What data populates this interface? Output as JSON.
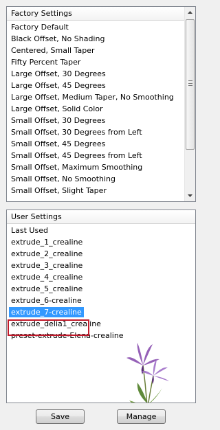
{
  "factory": {
    "header": "Factory Settings",
    "items": [
      "Factory Default",
      "Black Offset, No Shading",
      "Centered, Small Taper",
      "Fifty Percent Taper",
      "Large Offset, 30 Degrees",
      "Large Offset, 45 Degrees",
      "Large Offset, Medium Taper, No Smoothing",
      "Large Offset, Solid Color",
      "Small Offset, 30 Degrees",
      "Small Offset, 30 Degrees from Left",
      "Small Offset, 45 Degrees",
      "Small Offset, 45 Degrees from Left",
      "Small Offset, Maximum Smoothing",
      "Small Offset, No Smoothing",
      "Small Offset, Slight Taper"
    ]
  },
  "user": {
    "header": "User Settings",
    "items": [
      "Last Used",
      "extrude_1_crealine",
      "extrude_2_crealine",
      "extrude_3_crealine",
      "extrude_4_crealine",
      "extrude_5_crealine",
      "extrude_6-crealine",
      "extrude_7-crealine",
      "extrude_delia1_crealine",
      "preset-extrude-Elena-crealine"
    ],
    "selected_item": "extrude_7-crealine"
  },
  "buttons": {
    "save": "Save",
    "manage": "Manage"
  },
  "colors": {
    "selection": "#3399ff",
    "highlight_outline": "#c0192a"
  }
}
